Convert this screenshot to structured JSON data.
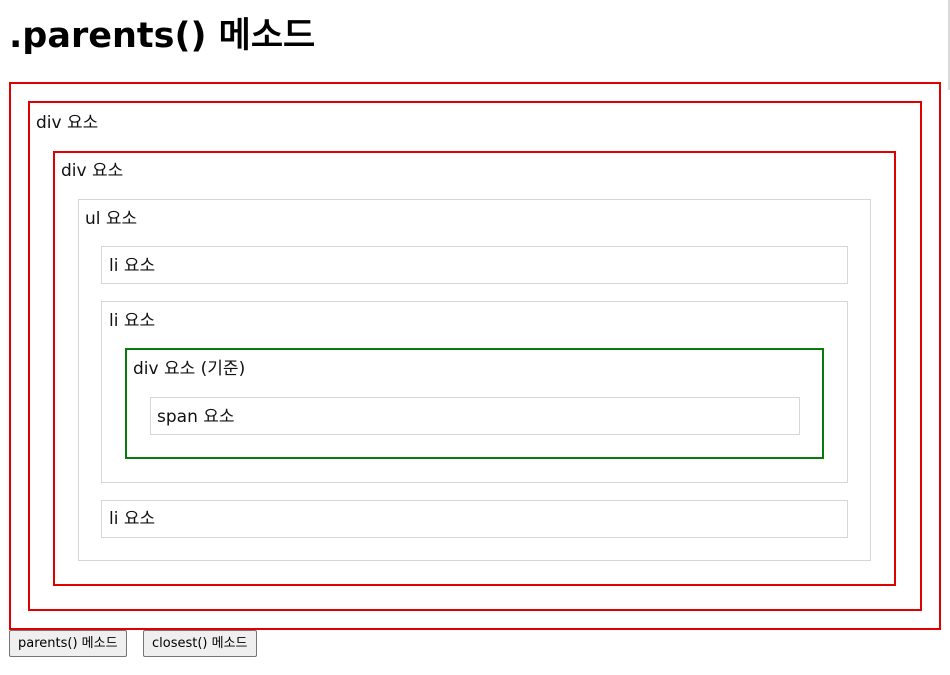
{
  "page": {
    "title": ".parents() 메소드"
  },
  "tree": {
    "outer_div": "div 요소",
    "inner_div": "div 요소",
    "ul": "ul 요소",
    "li_1": "li 요소",
    "li_2": "li 요소",
    "base_div": "div 요소 (기준)",
    "span": "span 요소",
    "li_3": "li 요소"
  },
  "buttons": {
    "parents": "parents() 메소드",
    "closest": "closest() 메소드"
  },
  "colors": {
    "highlight_parents": "#e00000",
    "base_element": "#0a7a0a",
    "default_border": "#d6d6d6"
  }
}
